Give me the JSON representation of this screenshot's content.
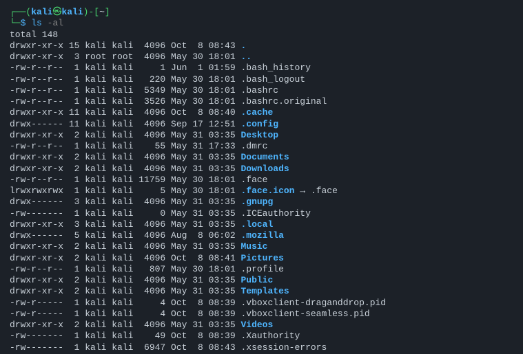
{
  "prompt": {
    "open1": "┌──(",
    "user": "kali",
    "at": "㉿",
    "host": "kali",
    "close1": ")-[",
    "path": "~",
    "close2": "]",
    "line2prefix": "└─",
    "dollar": "$",
    "cmd": "ls",
    "opt": " -al"
  },
  "total": "total 148",
  "rows": [
    {
      "perm": "drwxr-xr-x",
      "links": "15",
      "owner": "kali",
      "group": "kali",
      "size": "4096",
      "date": "Oct  8 08:43",
      "name": ".",
      "type": "dir"
    },
    {
      "perm": "drwxr-xr-x",
      "links": "3",
      "owner": "root",
      "group": "root",
      "size": "4096",
      "date": "May 30 18:01",
      "name": "..",
      "type": "dir"
    },
    {
      "perm": "-rw-r--r--",
      "links": "1",
      "owner": "kali",
      "group": "kali",
      "size": "1",
      "date": "Jun  1 01:59",
      "name": ".bash_history",
      "type": "file"
    },
    {
      "perm": "-rw-r--r--",
      "links": "1",
      "owner": "kali",
      "group": "kali",
      "size": "220",
      "date": "May 30 18:01",
      "name": ".bash_logout",
      "type": "file"
    },
    {
      "perm": "-rw-r--r--",
      "links": "1",
      "owner": "kali",
      "group": "kali",
      "size": "5349",
      "date": "May 30 18:01",
      "name": ".bashrc",
      "type": "file"
    },
    {
      "perm": "-rw-r--r--",
      "links": "1",
      "owner": "kali",
      "group": "kali",
      "size": "3526",
      "date": "May 30 18:01",
      "name": ".bashrc.original",
      "type": "file"
    },
    {
      "perm": "drwxr-xr-x",
      "links": "11",
      "owner": "kali",
      "group": "kali",
      "size": "4096",
      "date": "Oct  8 08:40",
      "name": ".cache",
      "type": "dir"
    },
    {
      "perm": "drwx------",
      "links": "11",
      "owner": "kali",
      "group": "kali",
      "size": "4096",
      "date": "Sep 17 12:51",
      "name": ".config",
      "type": "dir"
    },
    {
      "perm": "drwxr-xr-x",
      "links": "2",
      "owner": "kali",
      "group": "kali",
      "size": "4096",
      "date": "May 31 03:35",
      "name": "Desktop",
      "type": "dir"
    },
    {
      "perm": "-rw-r--r--",
      "links": "1",
      "owner": "kali",
      "group": "kali",
      "size": "55",
      "date": "May 31 17:33",
      "name": ".dmrc",
      "type": "file"
    },
    {
      "perm": "drwxr-xr-x",
      "links": "2",
      "owner": "kali",
      "group": "kali",
      "size": "4096",
      "date": "May 31 03:35",
      "name": "Documents",
      "type": "dir"
    },
    {
      "perm": "drwxr-xr-x",
      "links": "2",
      "owner": "kali",
      "group": "kali",
      "size": "4096",
      "date": "May 31 03:35",
      "name": "Downloads",
      "type": "dir"
    },
    {
      "perm": "-rw-r--r--",
      "links": "1",
      "owner": "kali",
      "group": "kali",
      "size": "11759",
      "date": "May 30 18:01",
      "name": ".face",
      "type": "file"
    },
    {
      "perm": "lrwxrwxrwx",
      "links": "1",
      "owner": "kali",
      "group": "kali",
      "size": "5",
      "date": "May 30 18:01",
      "name": ".face.icon",
      "type": "link",
      "arrow": "→",
      "target": ".face"
    },
    {
      "perm": "drwx------",
      "links": "3",
      "owner": "kali",
      "group": "kali",
      "size": "4096",
      "date": "May 31 03:35",
      "name": ".gnupg",
      "type": "dir"
    },
    {
      "perm": "-rw-------",
      "links": "1",
      "owner": "kali",
      "group": "kali",
      "size": "0",
      "date": "May 31 03:35",
      "name": ".ICEauthority",
      "type": "file"
    },
    {
      "perm": "drwxr-xr-x",
      "links": "3",
      "owner": "kali",
      "group": "kali",
      "size": "4096",
      "date": "May 31 03:35",
      "name": ".local",
      "type": "dir"
    },
    {
      "perm": "drwx------",
      "links": "5",
      "owner": "kali",
      "group": "kali",
      "size": "4096",
      "date": "Aug  8 06:02",
      "name": ".mozilla",
      "type": "dir"
    },
    {
      "perm": "drwxr-xr-x",
      "links": "2",
      "owner": "kali",
      "group": "kali",
      "size": "4096",
      "date": "May 31 03:35",
      "name": "Music",
      "type": "dir"
    },
    {
      "perm": "drwxr-xr-x",
      "links": "2",
      "owner": "kali",
      "group": "kali",
      "size": "4096",
      "date": "Oct  8 08:41",
      "name": "Pictures",
      "type": "dir"
    },
    {
      "perm": "-rw-r--r--",
      "links": "1",
      "owner": "kali",
      "group": "kali",
      "size": "807",
      "date": "May 30 18:01",
      "name": ".profile",
      "type": "file"
    },
    {
      "perm": "drwxr-xr-x",
      "links": "2",
      "owner": "kali",
      "group": "kali",
      "size": "4096",
      "date": "May 31 03:35",
      "name": "Public",
      "type": "dir"
    },
    {
      "perm": "drwxr-xr-x",
      "links": "2",
      "owner": "kali",
      "group": "kali",
      "size": "4096",
      "date": "May 31 03:35",
      "name": "Templates",
      "type": "dir"
    },
    {
      "perm": "-rw-r-----",
      "links": "1",
      "owner": "kali",
      "group": "kali",
      "size": "4",
      "date": "Oct  8 08:39",
      "name": ".vboxclient-draganddrop.pid",
      "type": "file"
    },
    {
      "perm": "-rw-r-----",
      "links": "1",
      "owner": "kali",
      "group": "kali",
      "size": "4",
      "date": "Oct  8 08:39",
      "name": ".vboxclient-seamless.pid",
      "type": "file"
    },
    {
      "perm": "drwxr-xr-x",
      "links": "2",
      "owner": "kali",
      "group": "kali",
      "size": "4096",
      "date": "May 31 03:35",
      "name": "Videos",
      "type": "dir"
    },
    {
      "perm": "-rw-------",
      "links": "1",
      "owner": "kali",
      "group": "kali",
      "size": "49",
      "date": "Oct  8 08:39",
      "name": ".Xauthority",
      "type": "file"
    },
    {
      "perm": "-rw-------",
      "links": "1",
      "owner": "kali",
      "group": "kali",
      "size": "6947",
      "date": "Oct  8 08:43",
      "name": ".xsession-errors",
      "type": "file"
    }
  ]
}
